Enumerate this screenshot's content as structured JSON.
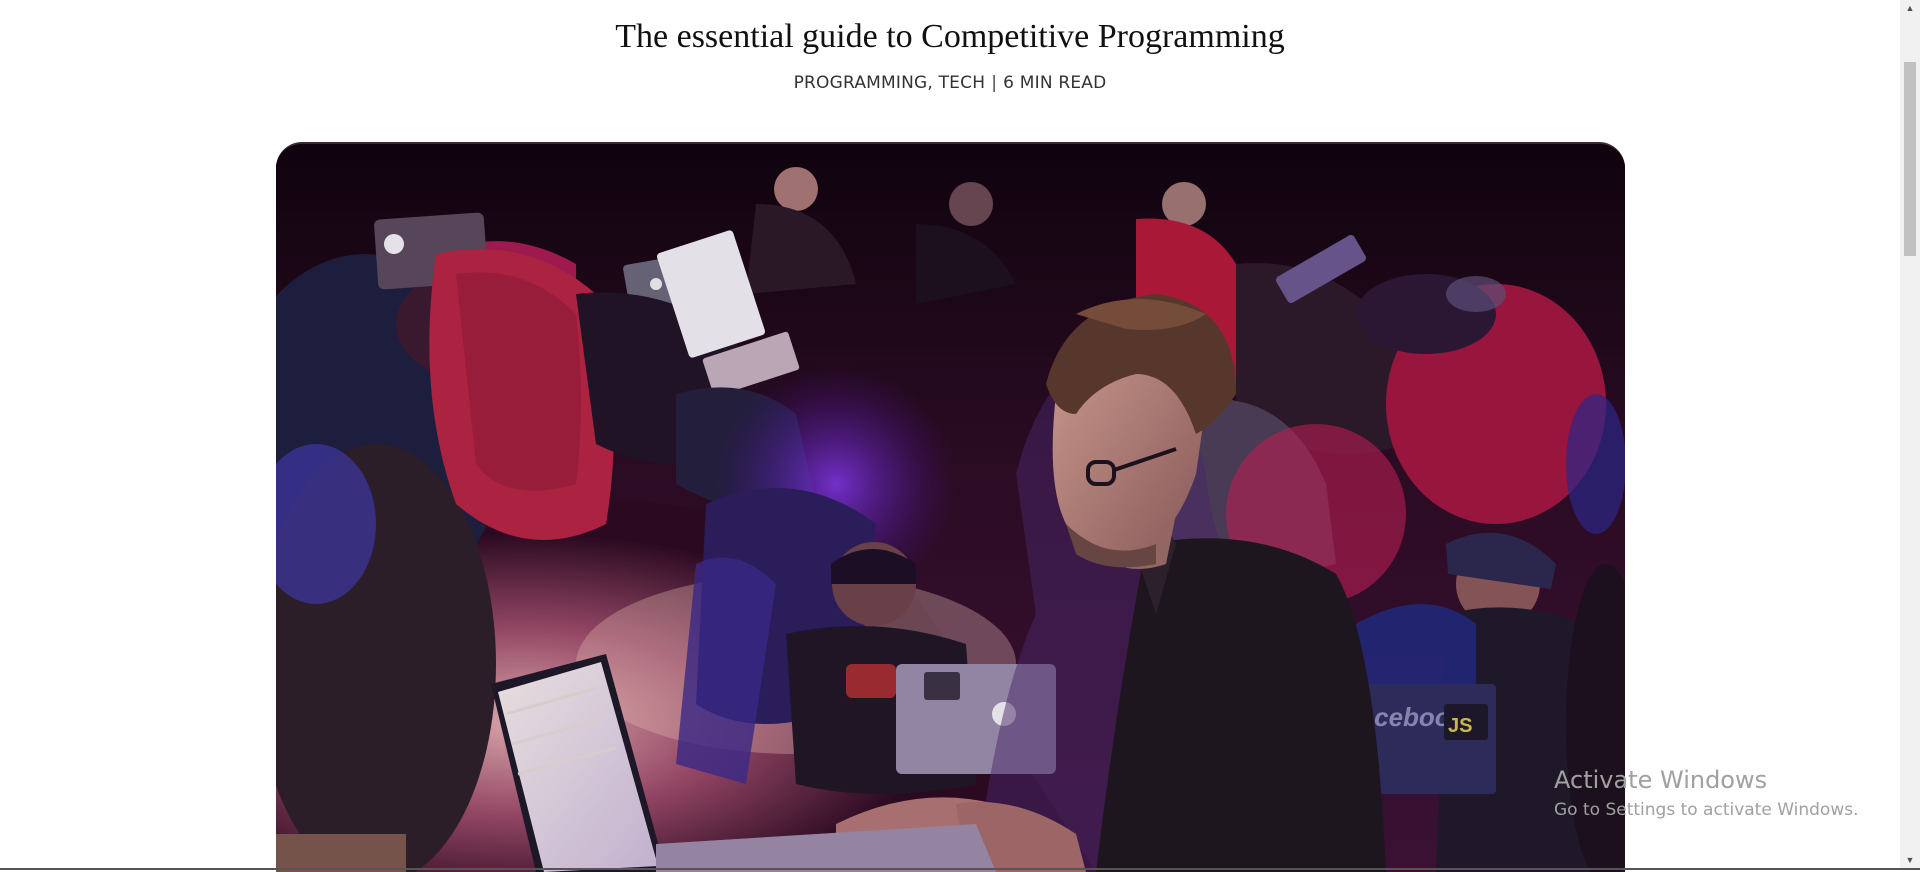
{
  "article": {
    "title": "The essential guide to Competitive Programming",
    "categories": "PROGRAMMING, TECH",
    "separator": "|",
    "read_time": "6 MIN READ"
  },
  "hero_image": {
    "laptop_label": "facebook",
    "sticker_label": "JS"
  },
  "watermark": {
    "title": "Activate Windows",
    "subtitle": "Go to Settings to activate Windows."
  },
  "scrollbar": {
    "up_arrow": "▲",
    "down_arrow": "▼"
  },
  "colors": {
    "accent_purple": "#7a2cff",
    "magenta": "#d01e6a",
    "dark_bg": "#16040f"
  }
}
